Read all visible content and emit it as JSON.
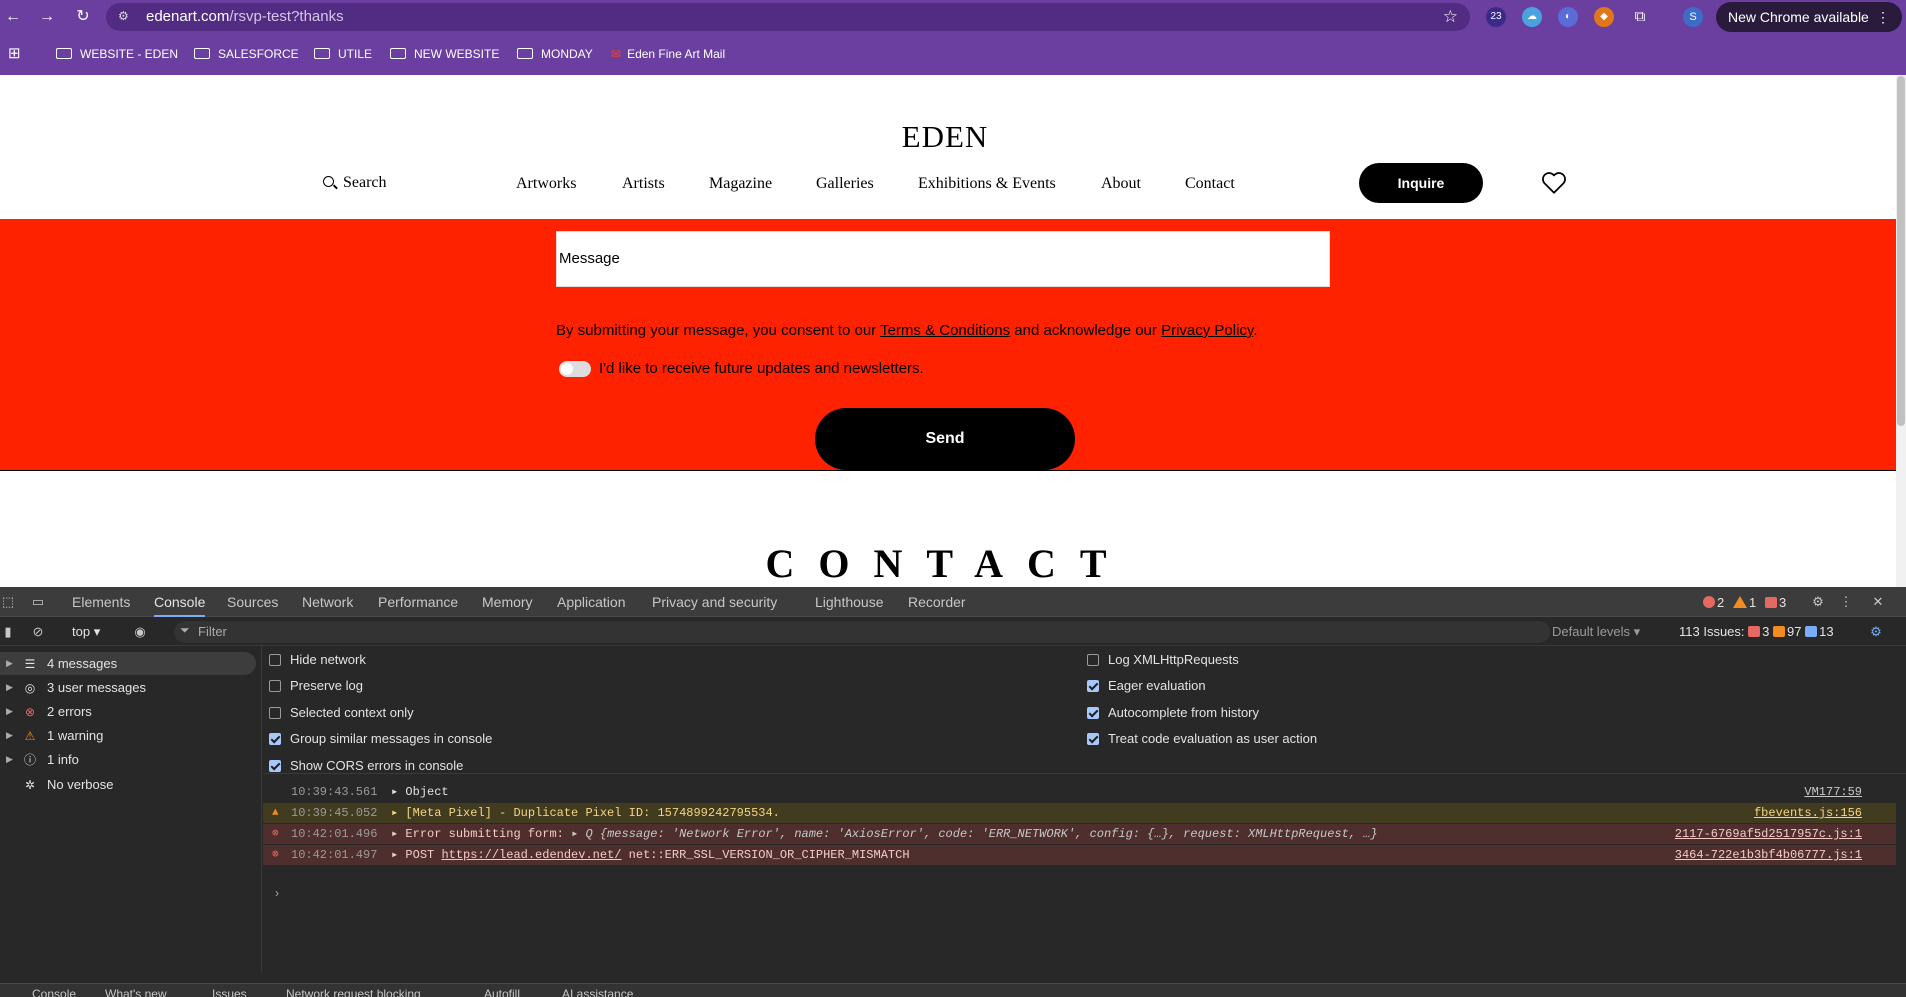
{
  "browser": {
    "url_host": "edenart.com",
    "url_path": "/rsvp-test?thanks",
    "new_chrome": "New Chrome available",
    "extension_badge": "23",
    "profile_initial": "S",
    "bookmarks": [
      "WEBSITE - EDEN",
      "SALESFORCE",
      "UTILE",
      "NEW WEBSITE",
      "MONDAY",
      "Eden Fine Art Mail"
    ]
  },
  "site": {
    "logo": "EDEN",
    "search": "Search",
    "nav": [
      "Artworks",
      "Artists",
      "Magazine",
      "Galleries",
      "Exhibitions & Events",
      "About",
      "Contact"
    ],
    "inquire": "Inquire",
    "message_placeholder": "Message",
    "consent_prefix": "By submitting your message, you consent to our ",
    "terms": "Terms & Conditions",
    "consent_mid": " and acknowledge our ",
    "privacy": "Privacy Policy",
    "consent_suffix": ".",
    "newsletter": "I'd like to receive future updates and newsletters.",
    "newsletter_on": false,
    "send": "Send",
    "contact_heading": "CONTACT",
    "band_color": "#ff2200"
  },
  "devtools": {
    "tabs": [
      "Elements",
      "Console",
      "Sources",
      "Network",
      "Performance",
      "Memory",
      "Application",
      "Privacy and security",
      "Lighthouse",
      "Recorder"
    ],
    "active_tab": "Console",
    "counts": {
      "errors": "2",
      "warnings": "1",
      "issues": "3"
    },
    "context": "top",
    "filter_placeholder": "Filter",
    "default_levels": "Default levels",
    "issues_label": "113 Issues:",
    "issues_counts": {
      "errors": "3",
      "warnings": "97",
      "info": "13"
    },
    "sidebar": [
      {
        "label": "4 messages",
        "icon": "list-icon"
      },
      {
        "label": "3 user messages",
        "icon": "user-icon"
      },
      {
        "label": "2 errors",
        "icon": "error-icon"
      },
      {
        "label": "1 warning",
        "icon": "warning-icon"
      },
      {
        "label": "1 info",
        "icon": "info-icon"
      },
      {
        "label": "No verbose",
        "icon": "bug-icon"
      }
    ],
    "settings_left": [
      {
        "label": "Hide network",
        "checked": false
      },
      {
        "label": "Preserve log",
        "checked": false
      },
      {
        "label": "Selected context only",
        "checked": false
      },
      {
        "label": "Group similar messages in console",
        "checked": true
      },
      {
        "label": "Show CORS errors in console",
        "checked": true
      }
    ],
    "settings_right": [
      {
        "label": "Log XMLHttpRequests",
        "checked": false
      },
      {
        "label": "Eager evaluation",
        "checked": true
      },
      {
        "label": "Autocomplete from history",
        "checked": true
      },
      {
        "label": "Treat code evaluation as user action",
        "checked": true
      }
    ],
    "log": [
      {
        "level": "info",
        "time": "10:39:43.561",
        "text": "▸ Object",
        "source": "VM177:59"
      },
      {
        "level": "warn",
        "time": "10:39:45.052",
        "text": "▸ [Meta Pixel] - Duplicate Pixel ID: 1574899242795534.",
        "source": "fbevents.js:156"
      },
      {
        "level": "error",
        "time": "10:42:01.496",
        "text": "▸ Error submitting form:",
        "object": "▸ Q {message: 'Network Error', name: 'AxiosError', code: 'ERR_NETWORK', config: {…}, request: XMLHttpRequest, …}",
        "source": "2117-6769af5d2517957c.js:1"
      },
      {
        "level": "error",
        "time": "10:42:01.497",
        "text": "▸ POST",
        "link": "https://lead.edendev.net/",
        "text2": " net::ERR_SSL_VERSION_OR_CIPHER_MISMATCH",
        "source": "3464-722e1b3bf4b06777.js:1"
      }
    ],
    "drawer_tabs": [
      "Console",
      "What's new",
      "Issues",
      "Network request blocking",
      "Autofill",
      "AI assistance"
    ]
  }
}
